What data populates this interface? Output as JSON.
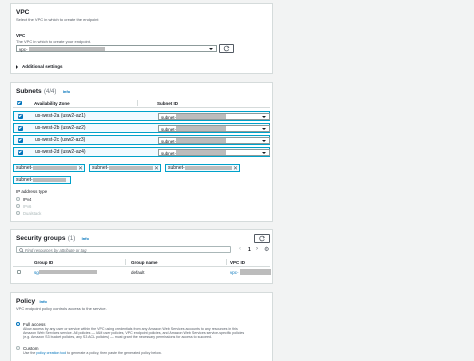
{
  "vpc": {
    "title": "VPC",
    "description": "Select the VPC in which to create the endpoint",
    "field_label": "VPC",
    "field_hint": "The VPC in which to create your endpoint.",
    "value_prefix": "vpc-",
    "additional_settings": "Additional settings"
  },
  "subnets": {
    "title": "Subnets",
    "count": "(4/4)",
    "info": "Info",
    "col_az": "Availability Zone",
    "col_subnet": "Subnet ID",
    "rows": [
      {
        "az": "us-west-2a (usw2-az1)",
        "subnet": "subnet-"
      },
      {
        "az": "us-west-2b (usw2-az2)",
        "subnet": "subnet-"
      },
      {
        "az": "us-west-2c (usw2-az3)",
        "subnet": "subnet-"
      },
      {
        "az": "us-west-2d (usw2-az4)",
        "subnet": "subnet-"
      }
    ],
    "tokens": [
      "subnet-",
      "subnet-",
      "subnet-",
      "subnet-"
    ],
    "ip_label": "IP address type",
    "ip_options": [
      "IPv4",
      "IPv6",
      "Dualstack"
    ]
  },
  "security_groups": {
    "title": "Security groups",
    "count": "(1)",
    "info": "Info",
    "search_placeholder": "Find resources by attribute or tag",
    "page": "1",
    "col_group_id": "Group ID",
    "col_group_name": "Group name",
    "col_vpc_id": "VPC ID",
    "row": {
      "group_id": "sg-",
      "group_name": "default",
      "vpc_id": "vpc-"
    }
  },
  "policy": {
    "title": "Policy",
    "info": "Info",
    "description": "VPC endpoint policy controls access to the service.",
    "full_access_label": "Full access",
    "full_access_desc_1": "Allow access by any user or service within the VPC using credentials from any Amazon Web Services accounts to any resources in this",
    "full_access_desc_2": "Amazon Web Services service. All policies — IAM user policies, VPC endpoint policies, and Amazon Web Services service-specific policies",
    "full_access_desc_3": "(e.g. Amazon S3 bucket policies, any S3 ACL policies) — must grant the necessary permissions for access to succeed.",
    "custom_label": "Custom",
    "custom_desc_prefix": "Use the",
    "custom_desc_link": "policy creation tool",
    "custom_desc_suffix": "to generate a policy, then paste the generated policy below."
  }
}
